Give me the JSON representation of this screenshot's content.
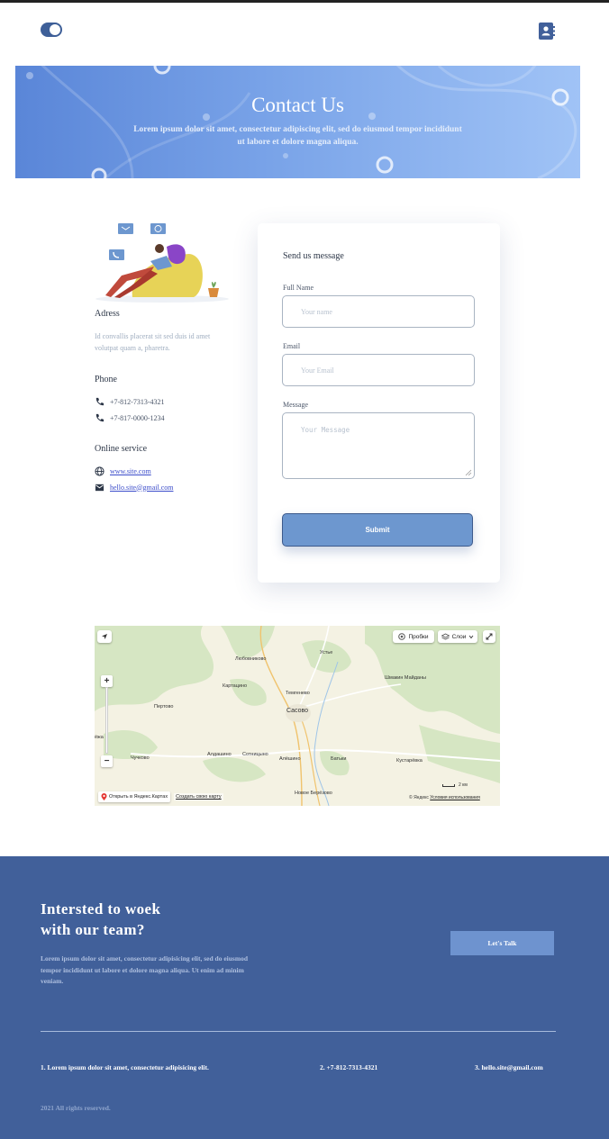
{
  "header": {
    "theme_toggle_icon": "theme-toggle",
    "contacts_icon": "contact-book"
  },
  "hero": {
    "title": "Contact Us",
    "subtitle": "Lorem ipsum dolor sit amet, consectetur adipiscing elit, sed do eiusmod tempor incididunt ut labore et dolore magna aliqua."
  },
  "info": {
    "address_heading": "Adress",
    "address_text": "Id convallis placerat sit sed duis id amet volutpat quam a, pharetra.",
    "phone_heading": "Phone",
    "phones": [
      "+7-812-7313-4321",
      "+7-817-0000-1234"
    ],
    "online_heading": "Online service",
    "website": "www.site.com",
    "email": "hello.site@gmail.com"
  },
  "form": {
    "title": "Send us message",
    "name_label": "Full Name",
    "name_placeholder": "Your name",
    "email_label": "Email",
    "email_placeholder": "Your Email",
    "message_label": "Message",
    "message_placeholder": "Your Message",
    "submit_label": "Submit"
  },
  "map": {
    "traffic_label": "Пробки",
    "layers_label": "Слои",
    "open_label": "Открыть в Яндекс.Картах",
    "create_label": "Создать свою карту",
    "scale_label": "2 км",
    "copyright": "© Яндекс",
    "terms": "Условия использования",
    "places": [
      "Устье",
      "Любовниково",
      "Шмакин Майданы",
      "Картацино",
      "Темгенево",
      "Пертово",
      "Сасово",
      "Алдашино",
      "Сотницыно",
      "Алёшино",
      "Батьки",
      "Кустарёвка",
      "Чучково",
      "Новое Берёзово",
      "ёжа"
    ]
  },
  "footer": {
    "heading_line1": "Intersted to woek",
    "heading_line2": "with our team?",
    "lead": "Lorem ipsum dolor sit amet, consectetur adipisicing elit, sed do eiusmod tempor incididunt ut labore et dolore magna aliqua. Ut enim ad minim veniam.",
    "cta_label": "Let's Talk",
    "item1": "1. Lorem ipsum dolor sit amet, consectetur adipisicing elit.",
    "item2": "2. +7-812-7313-4321",
    "item3": "3. hello.site@gmail.com",
    "copyright": "2021 All rights reserved."
  },
  "colors": {
    "primary": "#41609a",
    "accent": "#6d97cf",
    "hero_start": "#5a86d8",
    "hero_end": "#a0c3f6"
  }
}
